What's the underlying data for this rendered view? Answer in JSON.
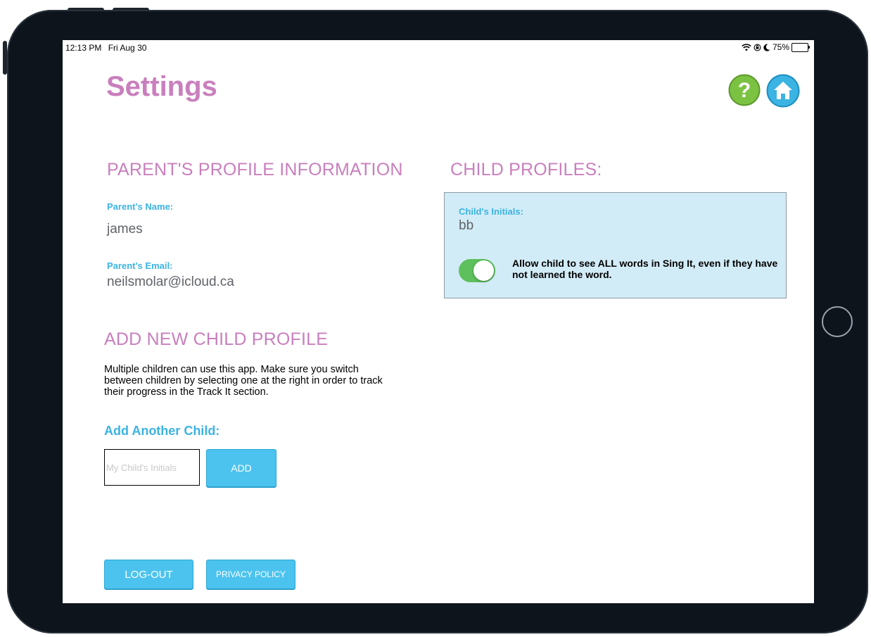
{
  "status_bar": {
    "time": "12:13 PM",
    "date": "Fri Aug 30",
    "battery": "75%"
  },
  "page": {
    "title": "Settings"
  },
  "header_icons": {
    "help": "question-mark-icon",
    "home": "house-icon",
    "help_color": "#7cc242",
    "home_color": "#3bb3e3"
  },
  "parent_profile": {
    "heading": "PARENT'S PROFILE INFORMATION",
    "name_label": "Parent's Name:",
    "name_value": "james",
    "email_label": "Parent's Email:",
    "email_value": "neilsmolar@icloud.ca"
  },
  "add_child": {
    "heading": "ADD NEW CHILD PROFILE",
    "description": "Multiple children can use this app. Make sure you switch between children by selecting one at the right in order to track their progress in the Track It section.",
    "subheading": "Add Another Child:",
    "input_placeholder": "My Child's Initials",
    "add_button": "ADD"
  },
  "child_profiles": {
    "heading": "CHILD PROFILES:",
    "items": [
      {
        "initials_label": "Child's Initials:",
        "initials": "bb",
        "toggle_on": true,
        "toggle_label": "Allow child to see ALL words in Sing It, even if they have not learned the word."
      }
    ]
  },
  "footer": {
    "logout_button": "LOG-OUT",
    "privacy_button": "PRIVACY POLICY"
  },
  "colors": {
    "heading_pink": "#c97fbd",
    "label_blue": "#3bb3e3",
    "button_blue": "#4cc3ee",
    "card_bg": "#d2ecf7",
    "toggle_green": "#5dc05c"
  }
}
